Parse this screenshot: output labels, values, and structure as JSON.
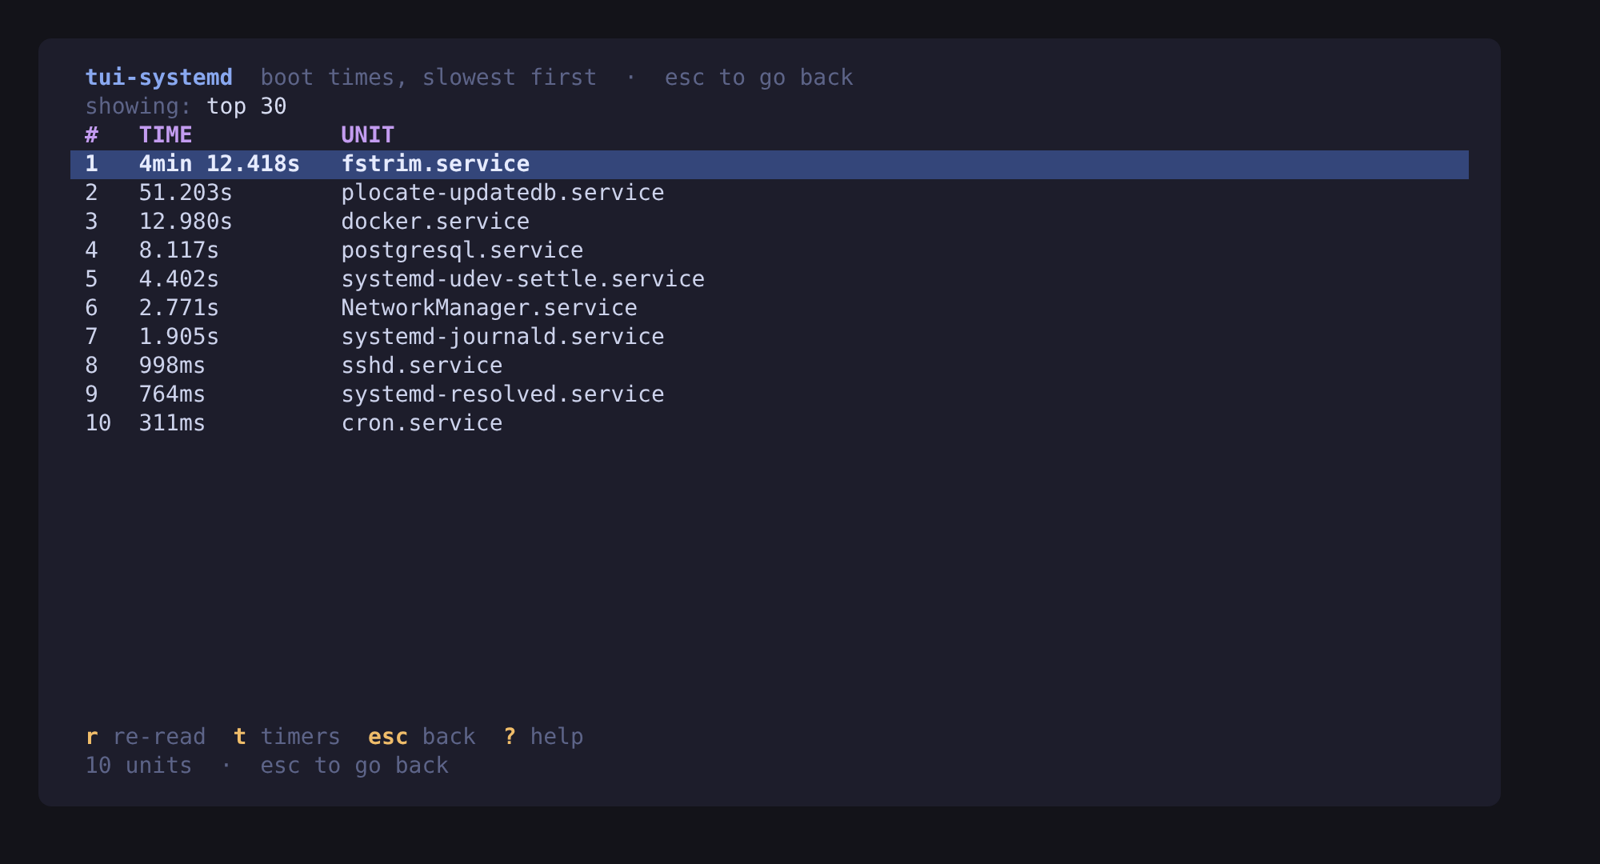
{
  "header": {
    "title": "tui-systemd",
    "subtitle": "boot times, slowest first  ·  esc to go back"
  },
  "filter": {
    "label": "showing:",
    "value": "top 30"
  },
  "table": {
    "columns": [
      "#",
      "TIME",
      "UNIT"
    ],
    "rows": [
      {
        "cells": [
          "1",
          "4min 12.418s",
          "fstrim.service"
        ],
        "selected": true
      },
      {
        "cells": [
          "2",
          "51.203s",
          "plocate-updatedb.service"
        ],
        "selected": false
      },
      {
        "cells": [
          "3",
          "12.980s",
          "docker.service"
        ],
        "selected": false
      },
      {
        "cells": [
          "4",
          "8.117s",
          "postgresql.service"
        ],
        "selected": false
      },
      {
        "cells": [
          "5",
          "4.402s",
          "systemd-udev-settle.service"
        ],
        "selected": false
      },
      {
        "cells": [
          "6",
          "2.771s",
          "NetworkManager.service"
        ],
        "selected": false
      },
      {
        "cells": [
          "7",
          "1.905s",
          "systemd-journald.service"
        ],
        "selected": false
      },
      {
        "cells": [
          "8",
          "998ms",
          "sshd.service"
        ],
        "selected": false
      },
      {
        "cells": [
          "9",
          "764ms",
          "systemd-resolved.service"
        ],
        "selected": false
      },
      {
        "cells": [
          "10",
          "311ms",
          "cron.service"
        ],
        "selected": false
      }
    ]
  },
  "keybindings": [
    {
      "key": "r",
      "label": "re-read"
    },
    {
      "key": "t",
      "label": "timers"
    },
    {
      "key": "esc",
      "label": "back"
    },
    {
      "key": "?",
      "label": "help"
    }
  ],
  "status_bar": "10 units  ·  esc to go back"
}
